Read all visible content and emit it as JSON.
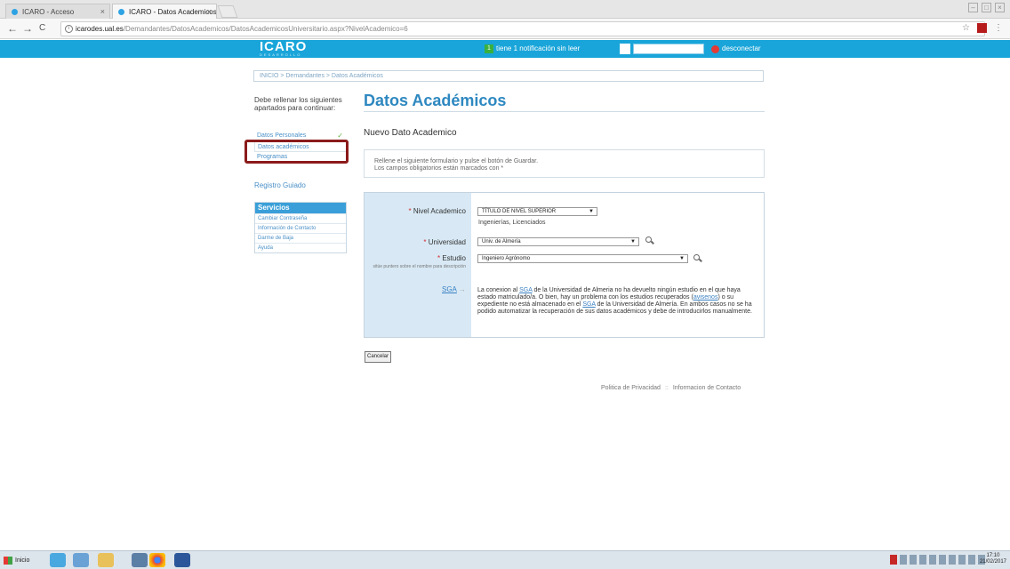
{
  "browser": {
    "tabs": [
      {
        "label": "ICARO - Acceso",
        "close": "×"
      },
      {
        "label": "ICARO - Datos Academicos",
        "close": "×"
      }
    ],
    "nav_back": "←",
    "nav_forward": "→",
    "nav_reload": "C",
    "url_info": "i",
    "url_host": "icarodes.ual.es",
    "url_path": "/Demandantes/DatosAcademicos/DatosAcademicosUniversitario.aspx?NivelAcademico=6",
    "star": "☆"
  },
  "site_header": {
    "logo": "ICARO",
    "logo_sub": "DESARROLLO",
    "notification_count": "1",
    "notification_text": "tiene 1 notificación sin leer",
    "logout_label": "desconectar",
    "bg_color": "#19a5d9"
  },
  "breadcrumb": "INICIO > Demandantes > Datos Académicos",
  "left": {
    "intro": "Debe rellenar los siguientes apartados para continuar:",
    "nav": [
      {
        "label": "Datos Personales",
        "check": "✓"
      },
      {
        "label": "Datos académicos",
        "check": ""
      },
      {
        "label": "Programas",
        "check": ""
      }
    ],
    "registro": "Registro Guiado",
    "servicios_title": "Servicios",
    "servicios_items": [
      "Cambiar Contraseña",
      "Información de Contacto",
      "Darme de Baja",
      "Ayuda"
    ]
  },
  "main": {
    "title": "Datos Académicos",
    "subheading": "Nuevo Dato Academico",
    "info_line1": "Rellene el siguiente formulario y pulse el botón de Guardar.",
    "info_line2": "Los campos obligatorios están marcados con *",
    "form": {
      "nivel_label": "Nivel Academico",
      "nivel_value": "TÍTULO DE NIVEL SUPERIOR",
      "nivel_sub": "Ingenierías, Licenciados",
      "universidad_label": "Universidad",
      "universidad_value": "Univ. de Almería",
      "estudio_label": "Estudio",
      "estudio_hint": "sitúe puntero sobre el nombre para descripción",
      "estudio_value": "Ingeniero Agrónomo",
      "sga_label": "SGA",
      "sga_arrow": "→",
      "sga_text_a": "La conexion al ",
      "sga_text_link1": "SGA",
      "sga_text_b": " de la Universidad de Almeria no ha devuelto ningún estudio en el que haya estado matriculado/a. O bien, hay un problema con los estudios recuperados (",
      "sga_text_link2": "avisenos",
      "sga_text_c": ") o su expediente no está almacenado en el ",
      "sga_text_link3": "SGA",
      "sga_text_d": " de la Universidad de Almería. En ambos casos no se ha podido automatizar la recuperación de sus datos académicos y debe de introducirlos manualmente.",
      "required_mark": "*",
      "dropdown_arrow": "▼"
    },
    "cancel_label": "Cancelar"
  },
  "footer": {
    "privacy": "Politica de Privacidad",
    "separator": "::",
    "contact": "Informacion de Contacto"
  },
  "taskbar": {
    "start_label": "Inicio",
    "time": "17:10",
    "date": "21/02/2017"
  }
}
